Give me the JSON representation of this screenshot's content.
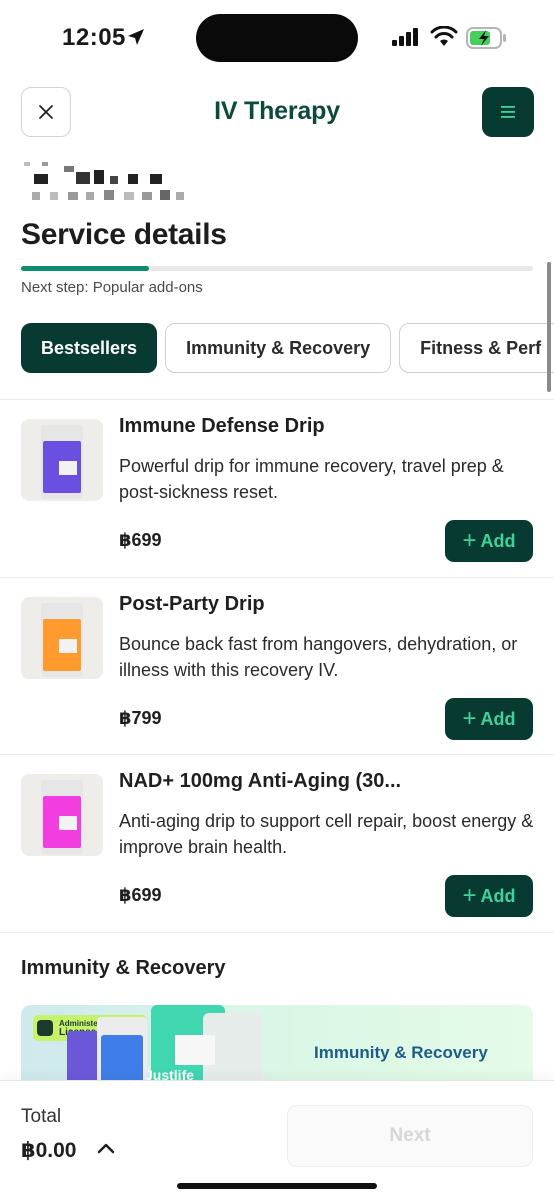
{
  "status_bar": {
    "time": "12:05"
  },
  "header": {
    "title": "IV Therapy",
    "close_icon": "close-icon",
    "menu_icon": "menu-icon"
  },
  "page": {
    "section_title": "Service details",
    "progress": 0.25,
    "next_step": "Next step: Popular add-ons"
  },
  "tabs": [
    {
      "label": "Bestsellers",
      "active": true
    },
    {
      "label": "Immunity & Recovery",
      "active": false
    },
    {
      "label": "Fitness & Perf",
      "active": false
    }
  ],
  "products": [
    {
      "name": "Immune Defense Drip",
      "description": "Powerful drip for immune recovery, travel prep & post-sickness reset.",
      "price": "฿699",
      "bag_color": "#6a4fe0",
      "add_label": "Add"
    },
    {
      "name": "Post-Party Drip",
      "description": "Bounce back fast from hangovers, dehydration, or illness with this recovery IV.",
      "price": "฿799",
      "bag_color": "#ff9a2e",
      "add_label": "Add"
    },
    {
      "name": "NAD+ 100mg Anti-Aging (30...",
      "description": "Anti-aging drip to support cell repair, boost energy & improve brain health.",
      "price": "฿699",
      "bag_color": "#f23ee0",
      "add_label": "Add"
    }
  ],
  "category": {
    "heading": "Immunity & Recovery",
    "banner_badge_line1": "Administered by",
    "banner_badge_line2": "Licensed Nurses",
    "banner_title": "Immunity & Recovery",
    "banner_product": "Justlife"
  },
  "footer": {
    "total_label": "Total",
    "total_value": "฿0.00",
    "next_label": "Next"
  },
  "colors": {
    "brand_dark": "#073b31",
    "accent_green": "#3fd29a",
    "progress": "#0f8a73"
  }
}
